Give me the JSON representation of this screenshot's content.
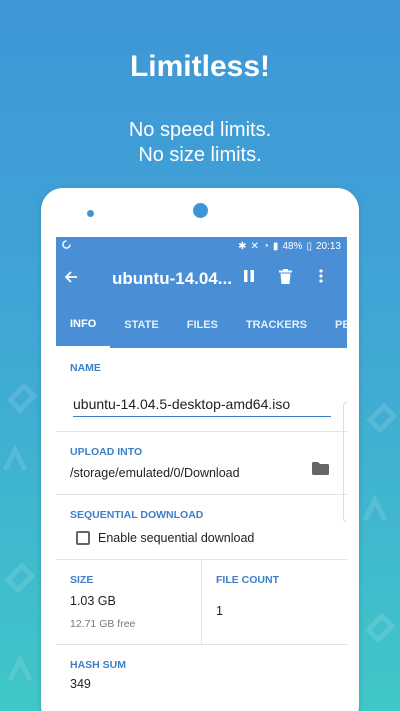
{
  "promo": {
    "headline": "Limitless!",
    "sub_line1": "No speed limits.",
    "sub_line2": "No size limits."
  },
  "status_bar": {
    "battery": "48%",
    "time": "20:13"
  },
  "app_bar": {
    "title": "ubuntu-14.04....",
    "back_icon": "arrow-back-icon",
    "pause_icon": "pause-icon",
    "delete_icon": "delete-icon",
    "more_icon": "more-vert-icon"
  },
  "tabs": [
    "INFO",
    "STATE",
    "FILES",
    "TRACKERS",
    "PEERS"
  ],
  "info": {
    "name_label": "NAME",
    "name_value": "ubuntu-14.04.5-desktop-amd64.iso",
    "upload_label": "UPLOAD INTO",
    "upload_path": "/storage/emulated/0/Download",
    "seq_label": "SEQUENTIAL DOWNLOAD",
    "seq_checkbox_label": "Enable sequential download",
    "seq_checked": false,
    "size_label": "SIZE",
    "size_value": "1.03 GB",
    "size_free": "12.71 GB free",
    "file_count_label": "FILE COUNT",
    "file_count_value": "1",
    "hash_label": "HASH SUM",
    "hash_value": "349"
  },
  "colors": {
    "accent": "#4a8fd6",
    "label": "#3d7fc8"
  }
}
